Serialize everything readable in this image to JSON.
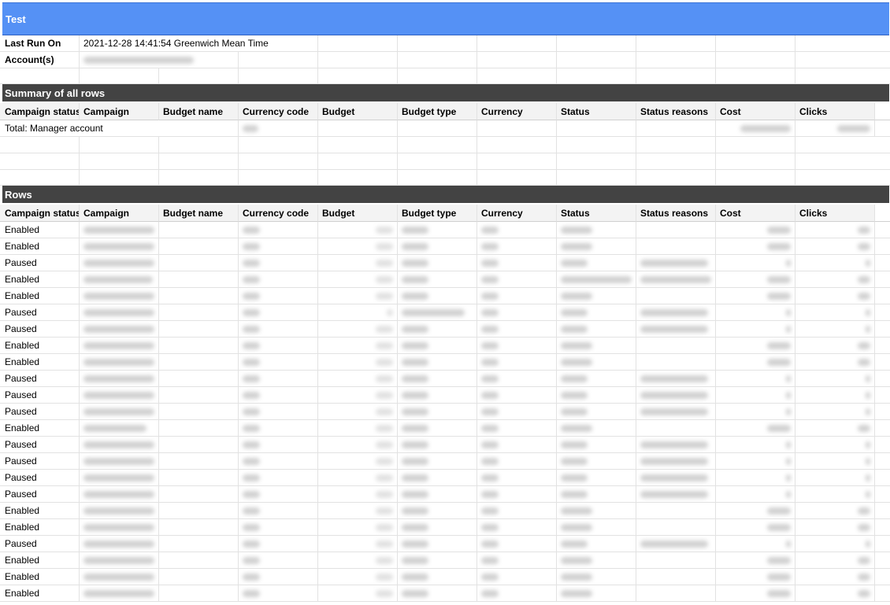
{
  "sheet": {
    "title": "Test",
    "meta": {
      "last_run_label": "Last Run On",
      "last_run_value": "2021-12-28 14:41:54 Greenwich Mean Time",
      "accounts_label": "Account(s)"
    },
    "summary": {
      "title": "Summary of all rows",
      "total_label": "Total: Manager account"
    },
    "rows_section": {
      "title": "Rows"
    },
    "columns": [
      "Campaign status",
      "Campaign",
      "Budget name",
      "Currency code",
      "Budget",
      "Budget type",
      "Currency",
      "Status",
      "Status reasons",
      "Cost",
      "Clicks"
    ],
    "row_statuses": [
      "Enabled",
      "Enabled",
      "Paused",
      "Enabled",
      "Enabled",
      "Paused",
      "Paused",
      "Enabled",
      "Enabled",
      "Paused",
      "Paused",
      "Paused",
      "Enabled",
      "Paused",
      "Paused",
      "Paused",
      "Paused",
      "Enabled",
      "Enabled",
      "Paused",
      "Enabled",
      "Enabled",
      "Enabled"
    ]
  }
}
